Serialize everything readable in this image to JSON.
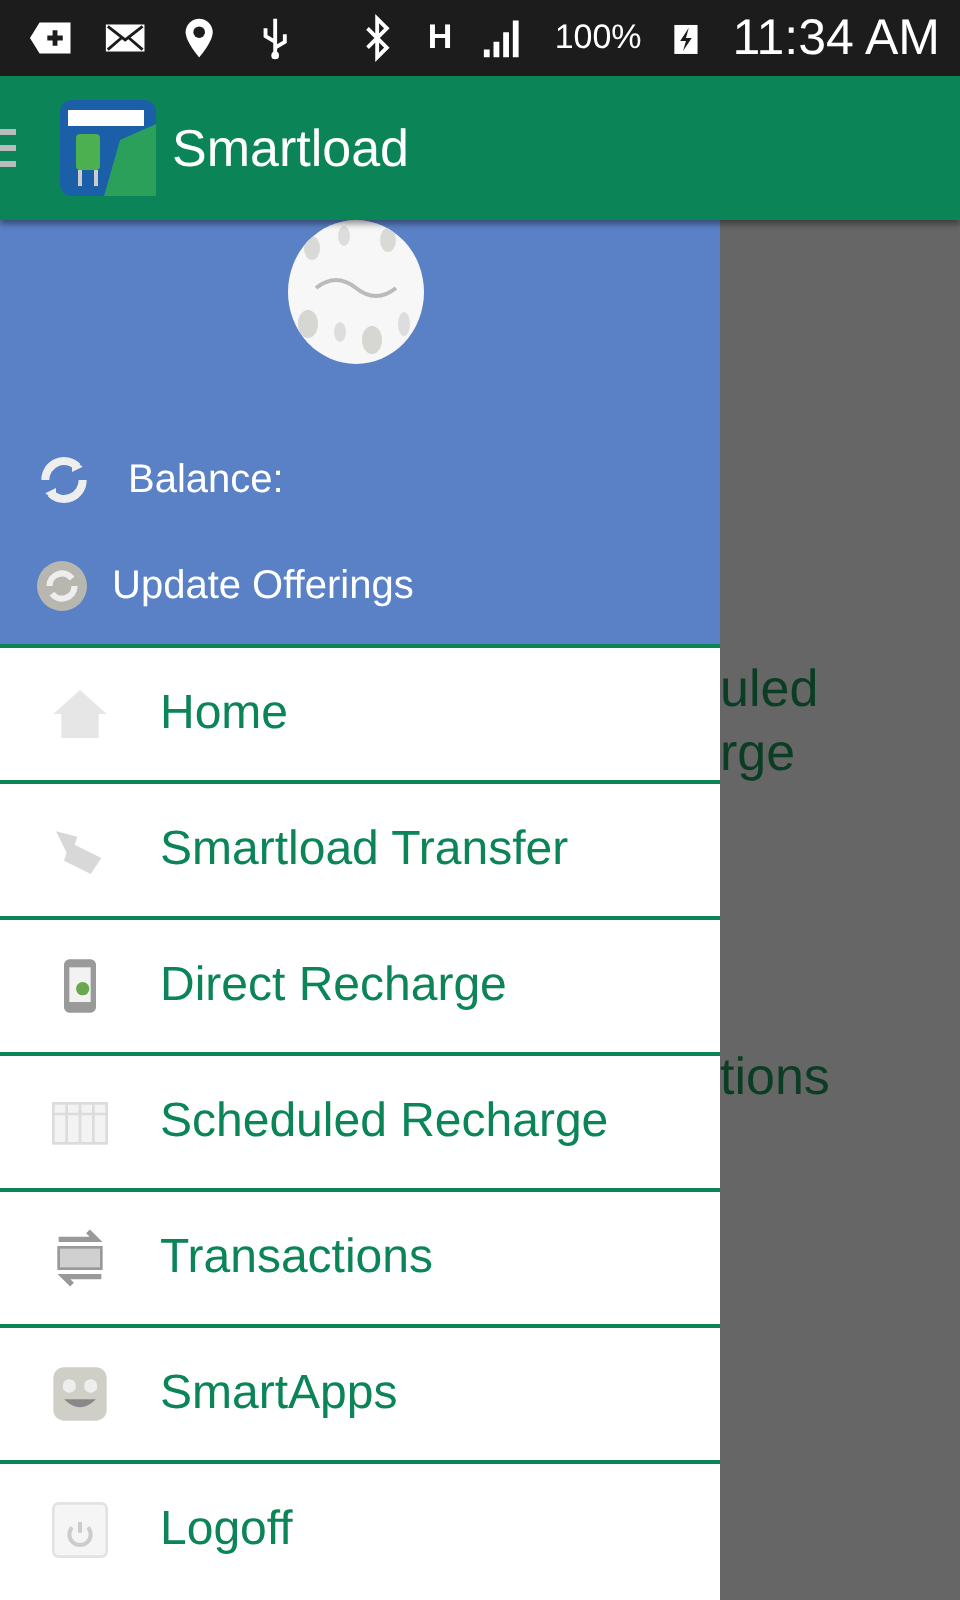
{
  "status_bar": {
    "network_type": "H",
    "battery": "100%",
    "time": "11:34 AM"
  },
  "app_bar": {
    "title": "Smartload"
  },
  "background_page": {
    "lines": [
      "uled",
      "rge",
      "tions"
    ]
  },
  "drawer": {
    "header": {
      "balance_label": "Balance:",
      "update_label": "Update Offerings"
    },
    "items": [
      {
        "label": "Home"
      },
      {
        "label": "Smartload Transfer"
      },
      {
        "label": "Direct Recharge"
      },
      {
        "label": "Scheduled Recharge"
      },
      {
        "label": "Transactions"
      },
      {
        "label": "SmartApps"
      },
      {
        "label": "Logoff"
      }
    ]
  }
}
